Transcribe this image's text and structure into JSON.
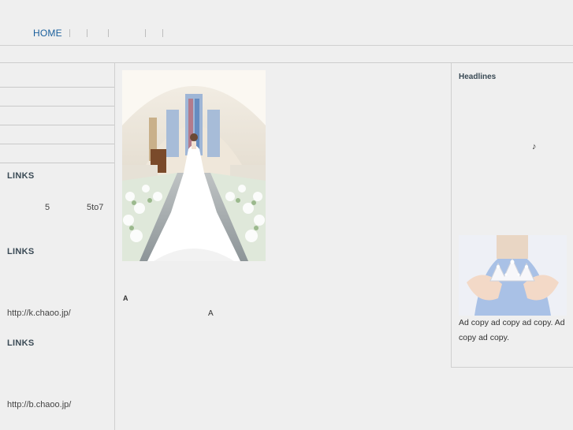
{
  "nav": {
    "home_label": "HOME"
  },
  "left": {
    "sections": [
      {
        "title": "LINKS",
        "items": [
          "5",
          "5to7"
        ]
      },
      {
        "title": "LINKS",
        "url": "http://k.chaoo.jp/"
      },
      {
        "title": "LINKS",
        "url": "http://b.chaoo.jp/"
      }
    ]
  },
  "center": {
    "caption_a": "A",
    "caption_a2": "A"
  },
  "right": {
    "headlines_label": "Headlines",
    "note_symbol": "♪",
    "ad_copy": "Ad copy ad copy ad copy. Ad copy ad copy."
  }
}
